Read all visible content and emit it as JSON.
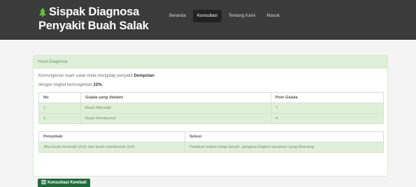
{
  "navbar": {
    "brand_line1": "Sispak Diagnosa",
    "brand_line2": "Penyakit Buah Salak",
    "brand_icon": "leaf-icon",
    "items": [
      {
        "label": "Beranda"
      },
      {
        "label": "Konsultasi"
      },
      {
        "label": "Tentang Kami"
      },
      {
        "label": "Masuk"
      }
    ]
  },
  "panel": {
    "heading": "Hasil Diagnosa",
    "intro_text": "Kemungkinan buah salak Anda mengidap penyakit",
    "disease": "Dompolan",
    "rate_text": "dengan tingkat kemungkinan",
    "rate_value": "22%."
  },
  "symptoms_table": {
    "headers": [
      "No",
      "Gejala yang dialami",
      "Poin Gejala"
    ],
    "rows": [
      [
        "1",
        "Buah Memutih",
        "7"
      ],
      [
        "2",
        "Buah Membusuk",
        "4"
      ]
    ]
  },
  "solution_table": {
    "headers": [
      "Penyebab",
      "Solusi"
    ],
    "rows": [
      [
        "Jika buah memutih (G3) dan buah membusuk (G4)",
        "Pastikan kebun tetap bersih, pangkas bagian tanaman yang diserang"
      ]
    ]
  },
  "back_button": {
    "label": "Konsultasi Kembali",
    "icon": "list-icon"
  },
  "colors": {
    "navbar": "#3b3b3b",
    "success_bg": "#dff0d8",
    "button": "#1f6b3c"
  }
}
